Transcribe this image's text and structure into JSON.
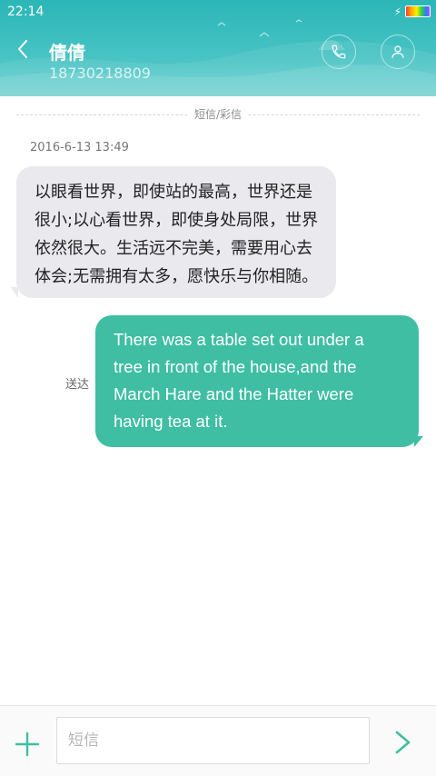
{
  "status_bar": {
    "time": "22:14",
    "icons": [
      "charging-bolt-icon",
      "battery-icon"
    ]
  },
  "header": {
    "contact_name": "倩倩",
    "contact_number": "18730218809",
    "icons": [
      "back-chevron-icon",
      "phone-icon",
      "person-icon"
    ],
    "accent_color": "#2bb6b7"
  },
  "conversation": {
    "divider_label": "短信/彩信",
    "timestamp": "2016-6-13 13:49",
    "incoming": {
      "lines": [
        "以眼看世界，即使站的最高，世界还是",
        "很小;以心看世界，即使身处局限，世界",
        "依然很大。生活远不完美，需要用心去",
        "体会;无需拥有太多，愿快乐与你相随。"
      ],
      "bubble_color": "#e9e9ee"
    },
    "outgoing": {
      "lines": [
        "There was a table set out under a",
        "tree in front of the house,and the",
        "March Hare and the Hatter were",
        "having tea at it."
      ],
      "status": "送达",
      "bubble_color": "#3fbea3"
    }
  },
  "compose": {
    "placeholder": "短信",
    "icons": [
      "plus-icon",
      "send-arrow-icon"
    ],
    "accent_color": "#3fbea3"
  }
}
